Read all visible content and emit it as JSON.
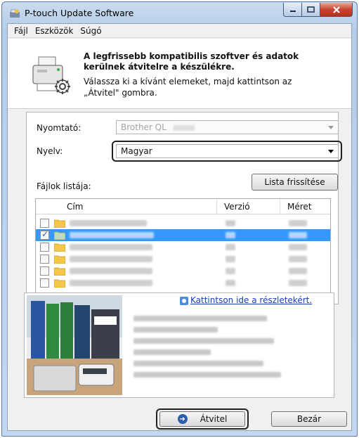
{
  "window": {
    "title": "P-touch Update Software"
  },
  "menu": {
    "items": [
      "Fájl",
      "Eszközök",
      "Súgó"
    ]
  },
  "header": {
    "bold_line1": "A legfrissebb kompatibilis szoftver és adatok",
    "bold_line2": "kerülnek átvitelre a készülékre.",
    "normal_line1": "Válassza ki a kívánt elemeket, majd kattintson az",
    "normal_line2": "„Átvitel\" gombra."
  },
  "form": {
    "printer_label": "Nyomtató:",
    "printer_value": "Brother QL",
    "language_label": "Nyelv:",
    "language_value": "Magyar",
    "file_list_label": "Fájlok listája:",
    "refresh_button": "Lista frissítése"
  },
  "table": {
    "columns": [
      "Cím",
      "Verzió",
      "Méret"
    ],
    "rows": [
      {
        "checked": false,
        "selected": false
      },
      {
        "checked": true,
        "selected": true
      },
      {
        "checked": false,
        "selected": false
      },
      {
        "checked": false,
        "selected": false
      },
      {
        "checked": false,
        "selected": false
      },
      {
        "checked": false,
        "selected": false
      }
    ]
  },
  "details": {
    "link_text": "Kattintson ide a részletekért."
  },
  "footer": {
    "transfer_button": "Átvitel",
    "close_button": "Bezár"
  },
  "colors": {
    "selection": "#3399ff",
    "link": "#1a3fb3",
    "close_button": "#c8442d"
  }
}
